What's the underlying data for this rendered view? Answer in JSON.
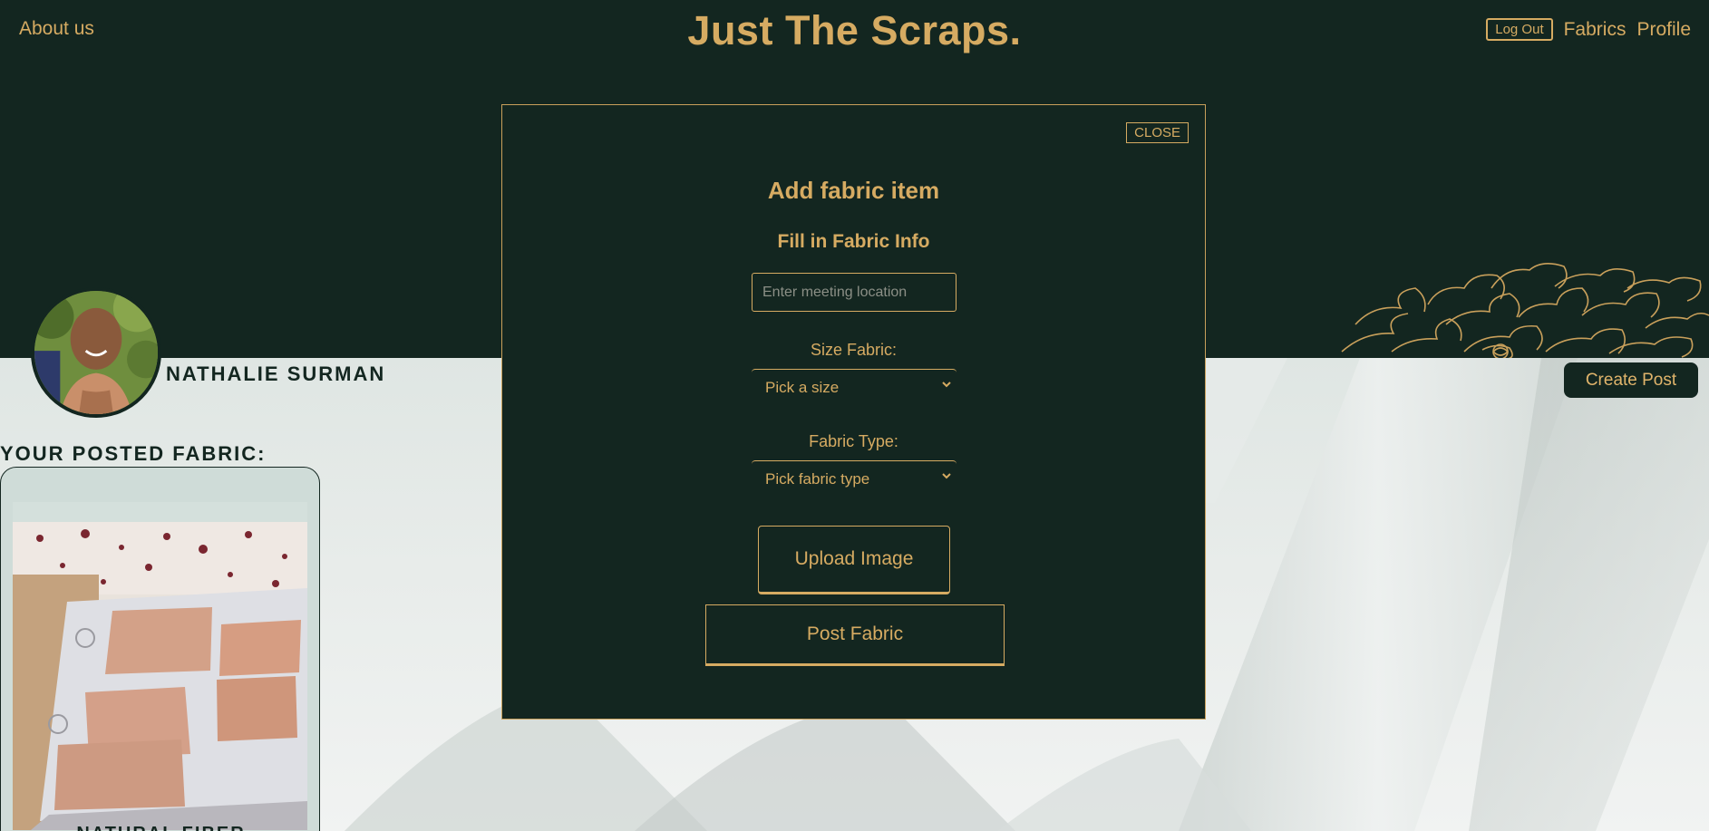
{
  "header": {
    "about_label": "About us",
    "site_title": "Just The Scraps.",
    "logout_label": "Log Out",
    "fabrics_label": "Fabrics",
    "profile_label": "Profile"
  },
  "profile": {
    "name": "NATHALIE SURMAN",
    "create_post_label": "Create Post",
    "posted_heading": "YOUR POSTED FABRIC:",
    "cards": [
      {
        "label": "NATURAL FIBER"
      }
    ]
  },
  "modal": {
    "close_label": "CLOSE",
    "title": "Add fabric item",
    "subtitle": "Fill in Fabric Info",
    "location_placeholder": "Enter meeting location",
    "size_label": "Size Fabric:",
    "size_selected": "Pick a size",
    "type_label": "Fabric Type:",
    "type_selected": "Pick fabric type",
    "upload_label": "Upload Image",
    "post_label": "Post Fabric"
  },
  "colors": {
    "dark_green": "#132620",
    "gold": "#d6ab62",
    "light_bg": "#dde3e1"
  },
  "icons": [
    "succulent-illustration",
    "chevron-down-icon"
  ]
}
